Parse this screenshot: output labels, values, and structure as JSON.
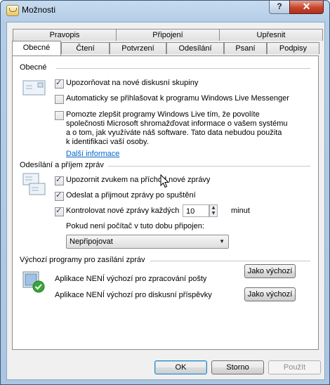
{
  "window": {
    "title": "Možnosti",
    "help_label": "?",
    "close_label": "✕"
  },
  "tabs_back": [
    {
      "label": "Pravopis"
    },
    {
      "label": "Připojení"
    },
    {
      "label": "Upřesnit"
    }
  ],
  "tabs_front": [
    {
      "label": "Obecné",
      "active": true
    },
    {
      "label": "Čtení"
    },
    {
      "label": "Potvrzení"
    },
    {
      "label": "Odesílání"
    },
    {
      "label": "Psaní"
    },
    {
      "label": "Podpisy"
    }
  ],
  "general": {
    "title": "Obecné",
    "options": [
      {
        "label": "Upozorňovat na nové diskusní skupiny",
        "checked": true
      },
      {
        "label": "Automaticky se přihlašovat k programu Windows Live Messenger",
        "checked": false
      },
      {
        "label_lines": [
          "Pomozte zlepšit programy Windows Live tím, že povolíte",
          "společnosti Microsoft shromažďovat informace o vašem systému",
          "a o tom, jak využíváte náš software. Tato data nebudou použita",
          "k identifikaci vaší osoby."
        ],
        "checked": false
      }
    ],
    "more_link": "Další informace"
  },
  "send_receive": {
    "title": "Odesílání a příjem zpráv",
    "options": [
      {
        "label": "Upozornit zvukem na příchod nové zprávy",
        "checked": true
      },
      {
        "label": "Odeslat a přijmout zprávy po spuštění",
        "checked": true
      },
      {
        "label": "Kontrolovat nové zprávy každých",
        "checked": true
      }
    ],
    "interval_value": "10",
    "interval_unit": "minut",
    "offline_label": "Pokud není počítač v tuto dobu připojen:",
    "offline_selected": "Nepřipojovat"
  },
  "default_programs": {
    "title": "Výchozí programy pro zasílání zpráv",
    "rows": [
      {
        "label": "Aplikace NENÍ výchozí pro zpracování pošty",
        "button": "Jako výchozí"
      },
      {
        "label": "Aplikace NENÍ výchozí pro diskusní příspěvky",
        "button": "Jako výchozí"
      }
    ]
  },
  "footer": {
    "ok": "OK",
    "cancel": "Storno",
    "apply": "Použít"
  },
  "colors": {
    "link": "#0066cc",
    "title_bar": "#b4cde6",
    "close_red": "#c8442c"
  },
  "icons": [
    "app-envelope-icon",
    "envelope-icon",
    "send-receive-icon",
    "default-program-check-icon",
    "mouse-cursor-icon"
  ]
}
